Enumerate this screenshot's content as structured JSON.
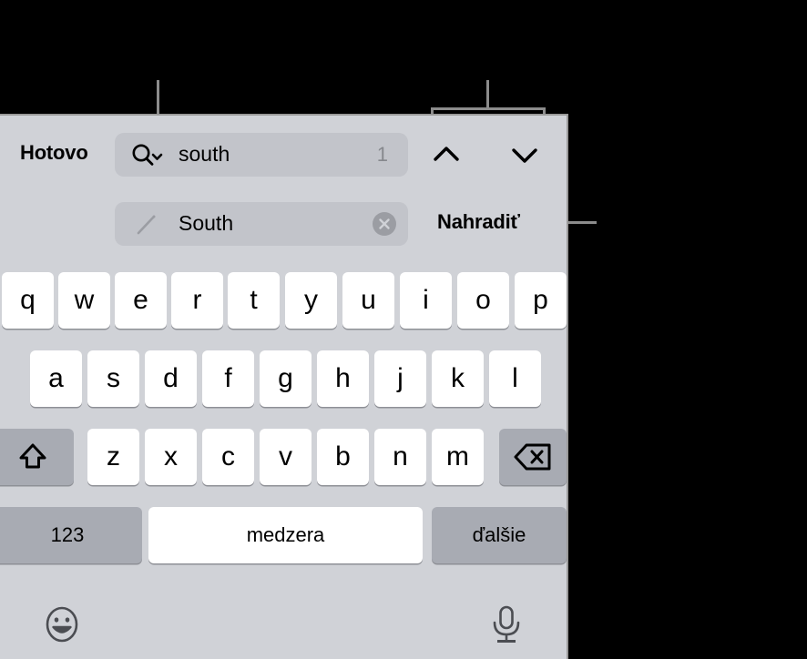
{
  "panel": {
    "done_label": "Hotovo",
    "replace_label": "Nahradiť"
  },
  "search": {
    "value": "south",
    "match_count": "1",
    "search_icon": "search-dropdown-icon",
    "prev_icon": "chevron-up-icon",
    "next_icon": "chevron-down-icon"
  },
  "replace": {
    "value": "South",
    "pencil_icon": "pencil-icon",
    "clear_icon": "clear-circle-icon"
  },
  "keyboard": {
    "row1": [
      "q",
      "w",
      "e",
      "r",
      "t",
      "y",
      "u",
      "i",
      "o",
      "p"
    ],
    "row2": [
      "a",
      "s",
      "d",
      "f",
      "g",
      "h",
      "j",
      "k",
      "l"
    ],
    "row3": [
      "z",
      "x",
      "c",
      "v",
      "b",
      "n",
      "m"
    ],
    "shift_icon": "shift-up-arrow-icon",
    "backspace_icon": "backspace-delete-icon",
    "numbers_label": "123",
    "space_label": "medzera",
    "next_label": "ďalšie",
    "emoji_icon": "emoji-smiley-icon",
    "mic_icon": "microphone-icon"
  },
  "colors": {
    "background": "#000000",
    "panel_bg": "#d0d2d7",
    "field_bg": "#c2c4ca",
    "key_bg": "#ffffff",
    "key_dark_bg": "#a8abb3",
    "callout_line": "#8c8c8c",
    "muted_text": "#86888d"
  }
}
